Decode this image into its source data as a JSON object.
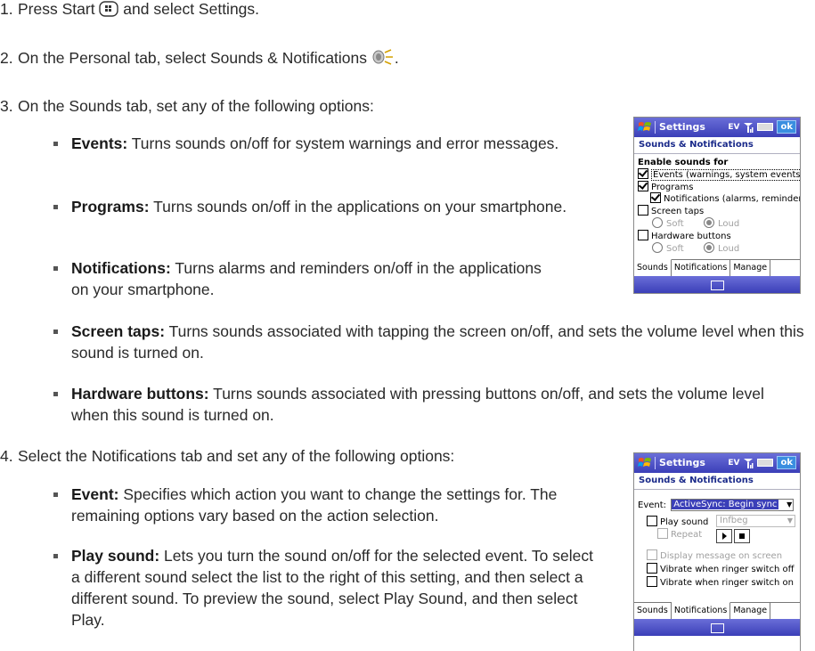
{
  "steps": [
    {
      "num": "1.",
      "text_before": "Press Start ",
      "text_after": " and select Settings."
    },
    {
      "num": "2.",
      "text_before": "On the Personal tab, select Sounds & Notifications ",
      "text_after": "."
    },
    {
      "num": "3.",
      "text": "On the Sounds tab, set any of the following options:"
    },
    {
      "num": "4.",
      "text": "Select the Notifications tab and set any of the following options:"
    }
  ],
  "sounds_options": [
    {
      "term": "Events:",
      "desc": " Turns sounds on/off for system warnings and error messages."
    },
    {
      "term": "Programs:",
      "desc": " Turns sounds on/off in the applications on your smartphone."
    },
    {
      "term": "Notifications:",
      "desc": " Turns alarms and reminders on/off in the applications on your smartphone."
    },
    {
      "term": "Screen taps:",
      "desc": " Turns sounds associated with tapping the screen on/off, and sets the volume level when this sound is turned on."
    },
    {
      "term": "Hardware buttons:",
      "desc": " Turns sounds associated with pressing buttons on/off, and sets the volume level when this sound is turned on."
    }
  ],
  "notifications_options": [
    {
      "term": "Event:",
      "desc": " Specifies which action you want to change the settings for. The remaining options vary based on the action selection."
    },
    {
      "term": "Play sound:",
      "desc": " Lets you turn the sound on/off for the selected event. To select a different sound select the list to the right of this setting, and then select a different sound. To preview the sound, select Play Sound, and then select Play."
    }
  ],
  "phone1": {
    "title": "Settings",
    "indicator": "EV",
    "ok": "ok",
    "header": "Sounds & Notifications",
    "section": "Enable sounds for",
    "events_label": "Events (warnings, system events)",
    "programs_label": "Programs",
    "notifications_label": "Notifications (alarms, reminders)",
    "screen_taps_label": "Screen taps",
    "hardware_label": "Hardware buttons",
    "soft": "Soft",
    "loud": "Loud",
    "tabs": [
      "Sounds",
      "Notifications",
      "Manage"
    ],
    "selected_tab": "Sounds"
  },
  "phone2": {
    "title": "Settings",
    "indicator": "EV",
    "ok": "ok",
    "header": "Sounds & Notifications",
    "event_label": "Event:",
    "event_value": "ActiveSync: Begin sync",
    "play_sound_label": "Play sound",
    "sound_value": "Infbeg",
    "repeat_label": "Repeat",
    "display_msg_label": "Display message on screen",
    "vibrate_off_label": "Vibrate when ringer switch off",
    "vibrate_on_label": "Vibrate when ringer switch on",
    "tabs": [
      "Sounds",
      "Notifications",
      "Manage"
    ],
    "selected_tab": "Notifications"
  }
}
